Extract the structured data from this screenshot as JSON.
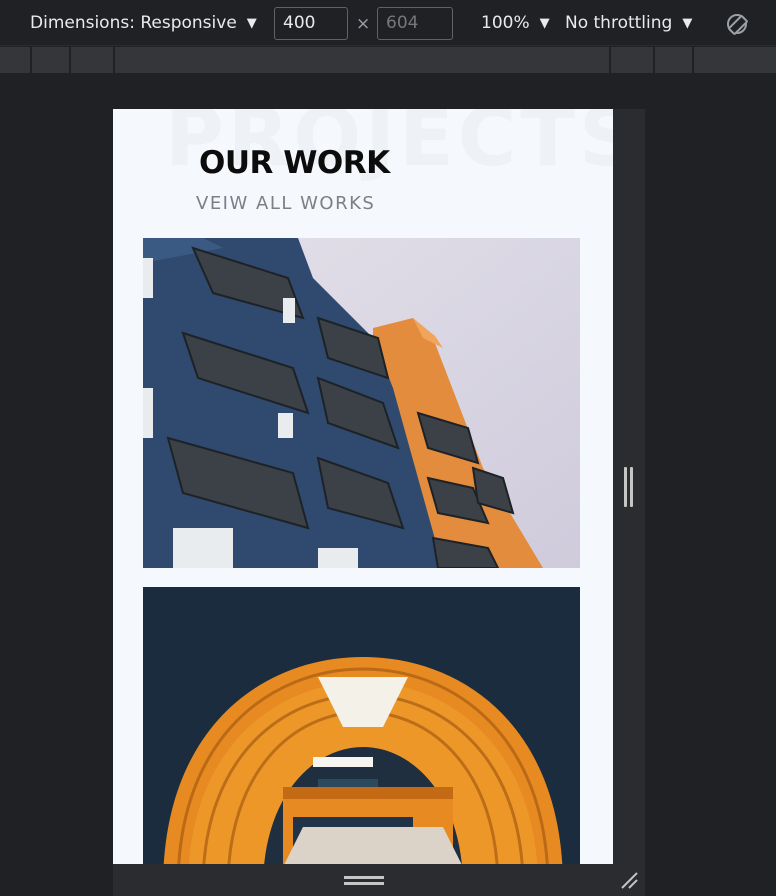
{
  "devtools": {
    "dimensions_label": "Dimensions: Responsive",
    "width_value": "400",
    "height_placeholder": "604",
    "times_symbol": "×",
    "zoom_label": "100%",
    "throttling_label": "No throttling",
    "caret": "▼"
  },
  "page": {
    "background_word": "PROJECTS",
    "title": "OUR WORK",
    "view_all_link": "VEIW ALL WORKS"
  },
  "images": [
    {
      "name": "project-image-building-balconies"
    },
    {
      "name": "project-image-orange-tunnel"
    }
  ]
}
